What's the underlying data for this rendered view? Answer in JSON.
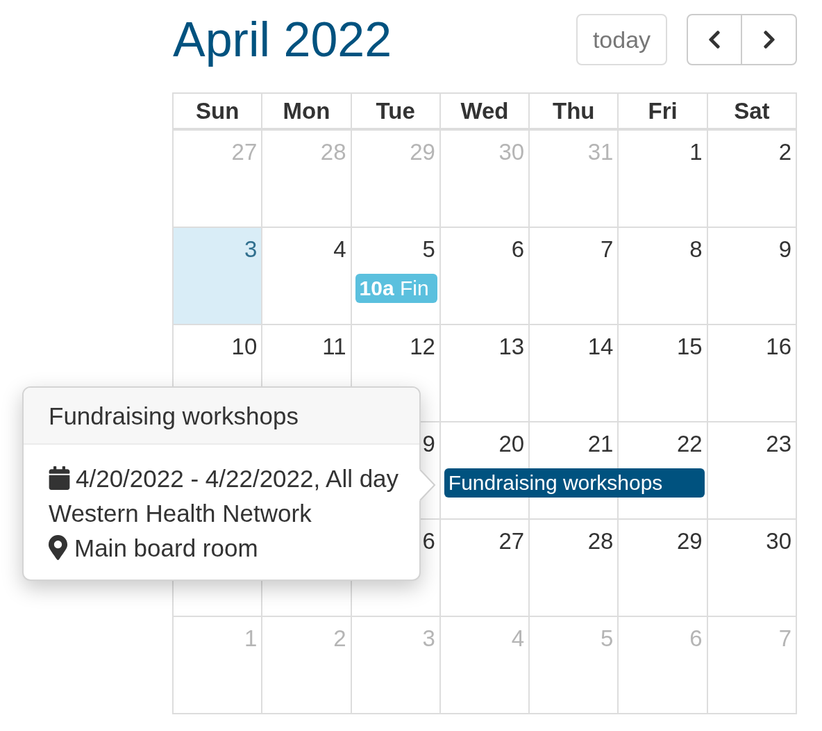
{
  "toolbar": {
    "title": "April 2022",
    "today_button": {
      "label": "today",
      "disabled": true
    }
  },
  "day_names": [
    "Sun",
    "Mon",
    "Tue",
    "Wed",
    "Thu",
    "Fri",
    "Sat"
  ],
  "weeks": [
    {
      "days": [
        {
          "kind": "date",
          "label": "27",
          "other_month": true,
          "today": false
        },
        {
          "kind": "date",
          "label": "28",
          "other_month": true,
          "today": false
        },
        {
          "kind": "date",
          "label": "29",
          "other_month": true,
          "today": false
        },
        {
          "kind": "date",
          "label": "30",
          "other_month": true,
          "today": false
        },
        {
          "kind": "date",
          "label": "31",
          "other_month": true,
          "today": false
        },
        {
          "kind": "date",
          "label": "1",
          "other_month": false,
          "today": false
        },
        {
          "kind": "date",
          "label": "2",
          "other_month": false,
          "today": false
        }
      ]
    },
    {
      "days": [
        {
          "kind": "date",
          "label": "3",
          "other_month": false,
          "today": true
        },
        {
          "kind": "date",
          "label": "4",
          "other_month": false,
          "today": false
        },
        {
          "kind": "date",
          "label": "5",
          "other_month": false,
          "today": false,
          "event": {
            "time": "10a",
            "title": "Fin",
            "color": "#5bc0de"
          }
        },
        {
          "kind": "date",
          "label": "6",
          "other_month": false,
          "today": false
        },
        {
          "kind": "date",
          "label": "7",
          "other_month": false,
          "today": false
        },
        {
          "kind": "date",
          "label": "8",
          "other_month": false,
          "today": false
        },
        {
          "kind": "date",
          "label": "9",
          "other_month": false,
          "today": false
        }
      ]
    },
    {
      "days": [
        {
          "kind": "date",
          "label": "10",
          "other_month": false,
          "today": false
        },
        {
          "kind": "date",
          "label": "11",
          "other_month": false,
          "today": false
        },
        {
          "kind": "date",
          "label": "12",
          "other_month": false,
          "today": false
        },
        {
          "kind": "date",
          "label": "13",
          "other_month": false,
          "today": false
        },
        {
          "kind": "date",
          "label": "14",
          "other_month": false,
          "today": false
        },
        {
          "kind": "date",
          "label": "15",
          "other_month": false,
          "today": false
        },
        {
          "kind": "date",
          "label": "16",
          "other_month": false,
          "today": false
        }
      ]
    },
    {
      "days": [
        {
          "kind": "covered"
        },
        {
          "kind": "covered"
        },
        {
          "kind": "date",
          "label": "9",
          "other_month": false,
          "today": false
        },
        {
          "kind": "date",
          "label": "20",
          "other_month": false,
          "today": false,
          "event": {
            "title": "Fundraising workshops",
            "color": "#00527f"
          }
        },
        {
          "kind": "date",
          "label": "21",
          "other_month": false,
          "today": false,
          "continues_event": true
        },
        {
          "kind": "date",
          "label": "22",
          "other_month": false,
          "today": false,
          "continues_event": true
        },
        {
          "kind": "date",
          "label": "23",
          "other_month": false,
          "today": false
        }
      ]
    },
    {
      "days": [
        {
          "kind": "date",
          "today": false
        },
        {
          "kind": "date",
          "today": false
        },
        {
          "kind": "date",
          "label": "6",
          "other_month": false,
          "today": false
        },
        {
          "kind": "date",
          "label": "27",
          "other_month": false,
          "today": false
        },
        {
          "kind": "date",
          "label": "28",
          "other_month": false,
          "today": false
        },
        {
          "kind": "date",
          "label": "29",
          "other_month": false,
          "today": false
        },
        {
          "kind": "date",
          "label": "30",
          "other_month": false,
          "today": false
        }
      ]
    },
    {
      "days": [
        {
          "kind": "date",
          "label": "1",
          "other_month": true,
          "today": false
        },
        {
          "kind": "date",
          "label": "2",
          "other_month": true,
          "today": false
        },
        {
          "kind": "date",
          "label": "3",
          "other_month": true,
          "today": false
        },
        {
          "kind": "date",
          "label": "4",
          "other_month": true,
          "today": false
        },
        {
          "kind": "date",
          "label": "5",
          "other_month": true,
          "today": false
        },
        {
          "kind": "date",
          "label": "6",
          "other_month": true,
          "today": false
        },
        {
          "kind": "date",
          "label": "7",
          "other_month": true,
          "today": false
        }
      ]
    }
  ],
  "popover": {
    "title": "Fundraising workshops",
    "dates": "4/20/2022 - 4/22/2022, All day",
    "organizer": "Western Health Network",
    "location": "Main board room"
  }
}
